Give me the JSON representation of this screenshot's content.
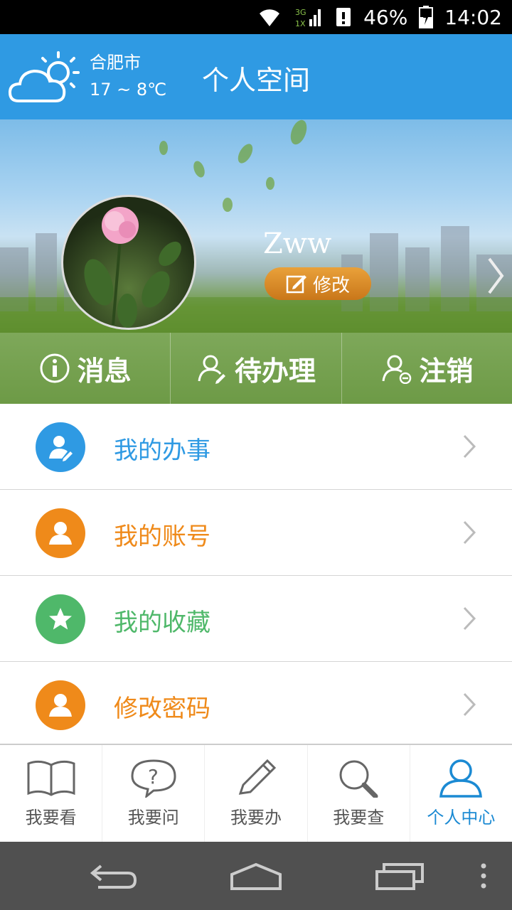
{
  "status": {
    "battery": "46%",
    "time": "14:02",
    "net": "3G 1X"
  },
  "header": {
    "city": "合肥市",
    "temperature": "17 ~ 8℃",
    "title": "个人空间"
  },
  "profile": {
    "username": "Zww",
    "edit_label": "修改"
  },
  "actions": [
    {
      "label": "消息",
      "icon": "info-icon"
    },
    {
      "label": "待办理",
      "icon": "user-edit-icon"
    },
    {
      "label": "注销",
      "icon": "user-minus-icon"
    }
  ],
  "menu": [
    {
      "label": "我的办事",
      "color": "#2f9ae3",
      "icon": "user-edit-icon"
    },
    {
      "label": "我的账号",
      "color": "#ef8a1a",
      "icon": "user-icon"
    },
    {
      "label": "我的收藏",
      "color": "#4fb86a",
      "icon": "star-icon"
    },
    {
      "label": "修改密码",
      "color": "#ef8a1a",
      "icon": "user-icon"
    }
  ],
  "tabs": [
    {
      "label": "我要看",
      "icon": "book-icon"
    },
    {
      "label": "我要问",
      "icon": "question-icon"
    },
    {
      "label": "我要办",
      "icon": "pencil-icon"
    },
    {
      "label": "我要查",
      "icon": "search-icon"
    },
    {
      "label": "个人中心",
      "icon": "user-icon",
      "active": true
    }
  ],
  "colors": {
    "brand": "#2f9ae3",
    "active_tab": "#1b8ad3"
  }
}
